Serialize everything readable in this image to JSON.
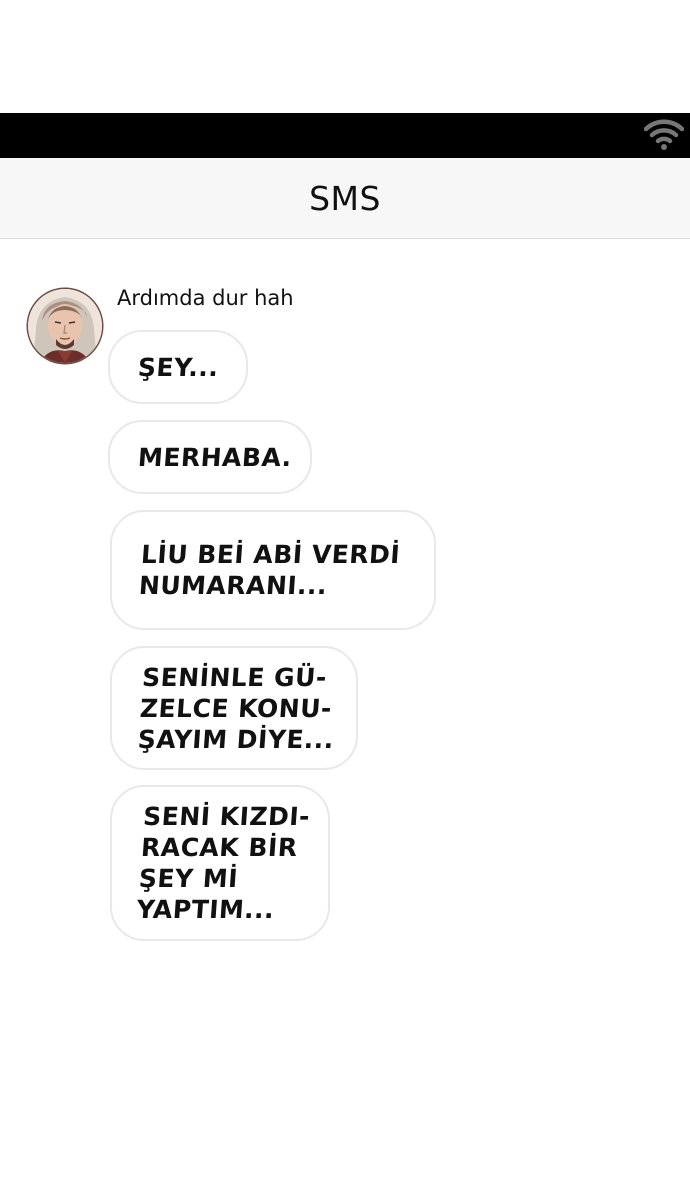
{
  "header": {
    "title": "SMS"
  },
  "status_bar": {
    "wifi_icon": "wifi-icon"
  },
  "conversation": {
    "sender_name": "Ardımda dur hah",
    "avatar_icon": "avatar",
    "messages": [
      "ŞEY...",
      "MERHABA.",
      "LİU BEİ ABİ VERDİ\nNUMARANI...",
      "SENİNLE GÜ-\nZELCE KONU-\nŞAYIM DİYE...",
      "SENİ KIZDI-\nRACAK BİR\nŞEY Mİ\nYAPTIM..."
    ]
  }
}
